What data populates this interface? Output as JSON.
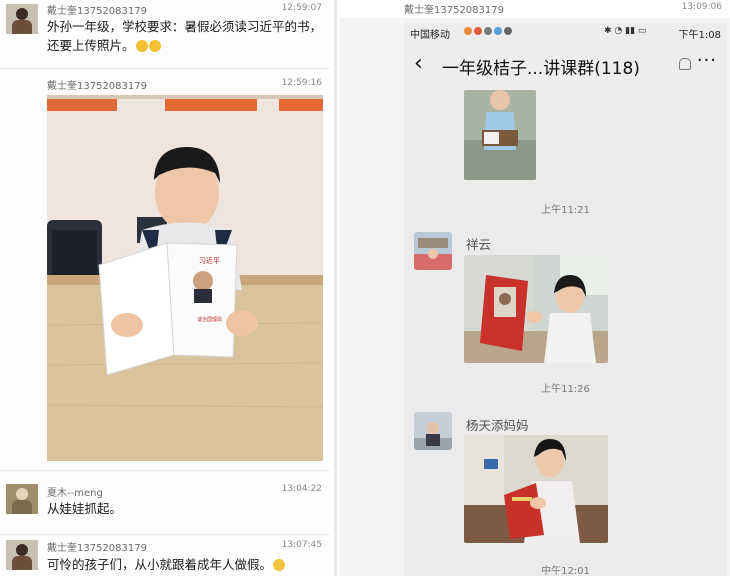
{
  "left": {
    "posts": [
      {
        "user": "戴士奎13752083179",
        "time": "12:59:07",
        "text": "外孙一年级，学校要求：暑假必须读习近平的书，还要上传照片。"
      },
      {
        "user": "戴士奎13752083179",
        "time": "12:59:16",
        "photo": "boy-reading-book-photo"
      },
      {
        "user": "夏木--meng",
        "time": "13:04:22",
        "text": "从娃娃抓起。"
      },
      {
        "user": "戴士奎13752083179",
        "time": "13:07:45",
        "text": "可怜的孩子们，从小就跟着成年人做假。"
      }
    ]
  },
  "right": {
    "post_user": "戴士奎13752083179",
    "post_time": "13:09:06",
    "status": {
      "carrier": "中国移动",
      "time": "下午1:08"
    },
    "chat_title": "一年级桔子...讲课群(118)",
    "timestamps": [
      "上午11:21",
      "上午11:26",
      "中午12:01"
    ],
    "messages": [
      {
        "name": "祥云"
      },
      {
        "name": "杨天添妈妈"
      }
    ]
  },
  "icons": {
    "back": "chevron-left-icon",
    "more": "ellipsis-icon",
    "mute": "bell-mute-icon"
  },
  "colors": {
    "wechat_header": "#ededed",
    "chat_bg": "#ebebeb",
    "text_dark": "#1a1a1a",
    "meta_gray": "#8a8a8a"
  }
}
